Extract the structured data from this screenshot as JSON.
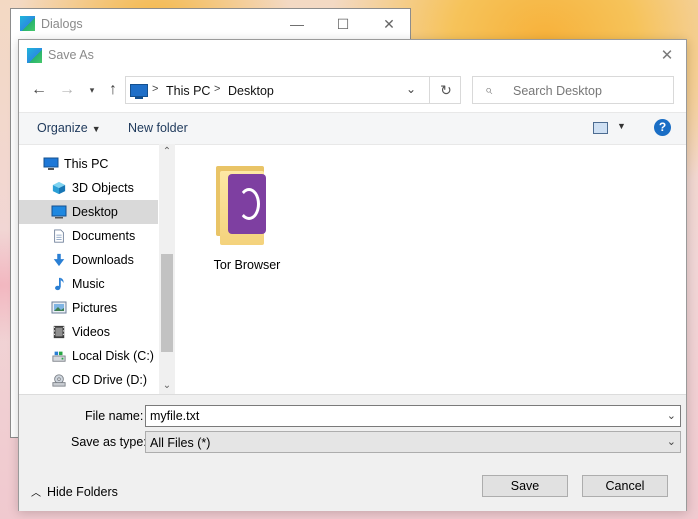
{
  "bg_window": {
    "title": "Dialogs",
    "buttons": {
      "minimize": "—",
      "maximize": "☐",
      "close": "✕"
    }
  },
  "dialog": {
    "title": "Save As",
    "close_glyph": "✕",
    "address": {
      "crumbs": [
        "This PC",
        "Desktop"
      ],
      "separator": ">"
    },
    "search": {
      "placeholder": "Search Desktop"
    },
    "toolbar": {
      "organize": "Organize",
      "new_folder": "New folder",
      "help": "?"
    },
    "nav": {
      "items": [
        {
          "label": "This PC",
          "icon": "computer-icon"
        },
        {
          "label": "3D Objects",
          "icon": "cube-icon"
        },
        {
          "label": "Desktop",
          "icon": "desktop-icon",
          "selected": true
        },
        {
          "label": "Documents",
          "icon": "document-icon"
        },
        {
          "label": "Downloads",
          "icon": "download-arrow-icon"
        },
        {
          "label": "Music",
          "icon": "music-note-icon"
        },
        {
          "label": "Pictures",
          "icon": "picture-icon"
        },
        {
          "label": "Videos",
          "icon": "film-icon"
        },
        {
          "label": "Local Disk (C:)",
          "icon": "disk-icon"
        },
        {
          "label": "CD Drive (D:)",
          "icon": "cd-drive-icon"
        }
      ]
    },
    "content": {
      "items": [
        {
          "label": "Tor Browser",
          "icon": "folder-tor-icon"
        }
      ]
    },
    "filename": {
      "label": "File name:",
      "value": "myfile.txt"
    },
    "savetype": {
      "label": "Save as type:",
      "value": "All Files (*)"
    },
    "hide_folders": "Hide Folders",
    "save": "Save",
    "cancel": "Cancel"
  },
  "colors": {
    "accent": "#1a6ec5",
    "selection": "#d9d9d9",
    "tor_purple": "#7e3fa1"
  }
}
